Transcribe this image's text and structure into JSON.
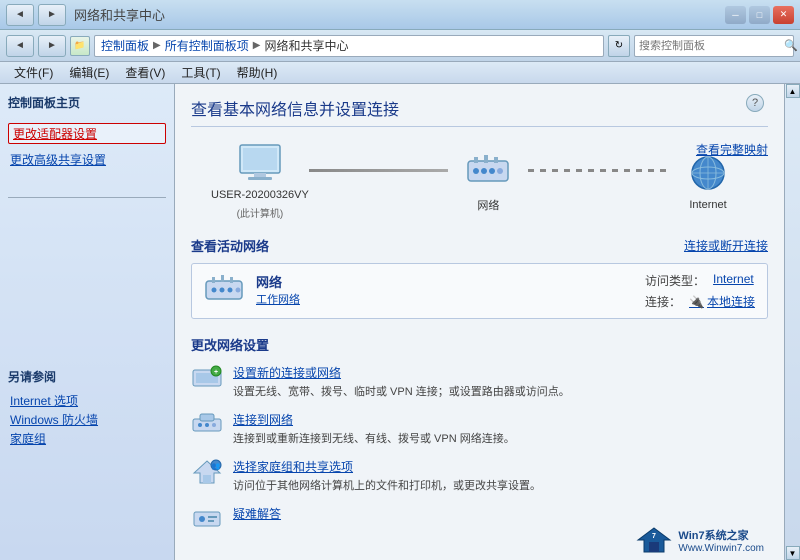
{
  "titlebar": {
    "title": "网络和共享中心",
    "nav_back": "◄",
    "nav_forward": "►",
    "btn_minimize": "─",
    "btn_maximize": "□",
    "btn_close": "✕"
  },
  "addressbar": {
    "path_parts": [
      "控制面板",
      "所有控制面板项",
      "网络和共享中心"
    ],
    "refresh": "↻",
    "search_placeholder": "搜索控制面板",
    "search_icon": "🔍"
  },
  "menubar": {
    "items": [
      "文件(F)",
      "编辑(E)",
      "查看(V)",
      "工具(T)",
      "帮助(H)"
    ]
  },
  "sidebar": {
    "section_title": "控制面板主页",
    "links": [
      {
        "label": "更改适配器设置",
        "active": true
      },
      {
        "label": "更改高级共享设置",
        "active": false
      }
    ],
    "extra_section": "另请参阅",
    "extra_links": [
      "Internet 选项",
      "Windows 防火墙",
      "家庭组"
    ]
  },
  "content": {
    "help": "?",
    "title": "查看基本网络信息并设置连接",
    "see_full_map": "查看完整映射",
    "network_nodes": [
      {
        "label": "USER-20200326VY",
        "sublabel": "(此计算机)"
      },
      {
        "label": "网络",
        "sublabel": ""
      },
      {
        "label": "Internet",
        "sublabel": ""
      }
    ],
    "active_network": {
      "section_label": "查看活动网络",
      "action": "连接或断开连接",
      "name": "网络",
      "type": "工作网络",
      "access_type_label": "访问类型：",
      "access_type_val": "Internet",
      "connection_label": "连接：",
      "connection_val": "本地连接",
      "connection_icon": "🔌"
    },
    "change_settings": {
      "section_label": "更改网络设置",
      "items": [
        {
          "link": "设置新的连接或网络",
          "desc": "设置无线、宽带、拨号、临时或 VPN 连接；或设置路由器或访问点。"
        },
        {
          "link": "连接到网络",
          "desc": "连接到或重新连接到无线、有线、拨号或 VPN 网络连接。"
        },
        {
          "link": "选择家庭组和共享选项",
          "desc": "访问位于其他网络计算机上的文件和打印机，或更改共享设置。"
        },
        {
          "link": "疑难解答",
          "desc": ""
        }
      ]
    }
  },
  "watermark": {
    "logo": "Win7系统之家",
    "url": "Www.Winwin7.com"
  }
}
